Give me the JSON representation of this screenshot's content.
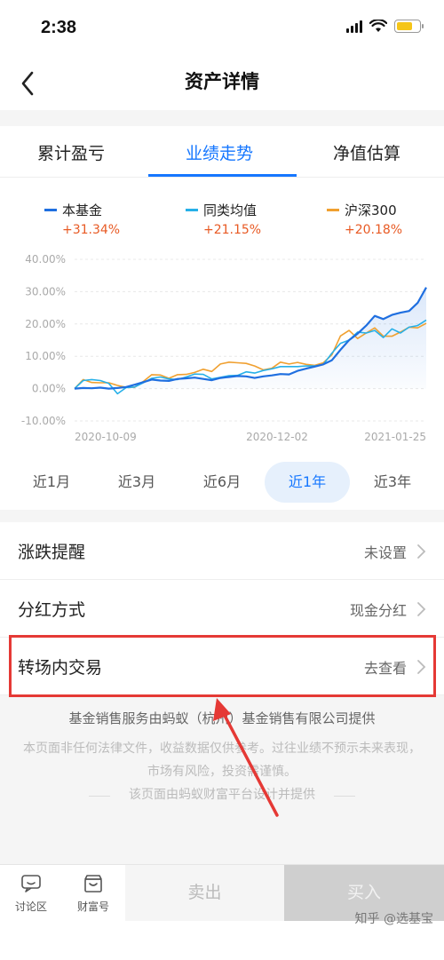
{
  "status_bar": {
    "time": "2:38",
    "battery_color": "#f5c518"
  },
  "nav": {
    "title": "资产详情",
    "back_icon": "chevron-left-icon"
  },
  "tabs": [
    {
      "label": "累计盈亏",
      "active": false
    },
    {
      "label": "业绩走势",
      "active": true
    },
    {
      "label": "净值估算",
      "active": false
    }
  ],
  "legend": [
    {
      "name": "本基金",
      "value": "+31.34%",
      "color": "#1f6fe0"
    },
    {
      "name": "同类均值",
      "value": "+21.15%",
      "color": "#26b0e8"
    },
    {
      "name": "沪深300",
      "value": "+20.18%",
      "color": "#f0a030"
    }
  ],
  "chart_data": {
    "type": "line",
    "ylabels": [
      "40.00%",
      "30.00%",
      "20.00%",
      "10.00%",
      "0.00%",
      "-10.00%"
    ],
    "ylim": [
      -10,
      40
    ],
    "xlabels": [
      "2020-10-09",
      "2020-12-02",
      "2021-01-25"
    ],
    "series": [
      {
        "name": "本基金",
        "color": "#1f6fe0",
        "values": [
          0,
          0.2,
          0.1,
          0.3,
          0,
          0.2,
          0.5,
          1.2,
          2.0,
          2.8,
          2.5,
          2.4,
          3.0,
          3.2,
          3.4,
          3.0,
          2.6,
          3.3,
          3.6,
          3.9,
          3.8,
          3.3,
          3.8,
          4.1,
          4.5,
          4.4,
          5.5,
          6.2,
          6.8,
          7.5,
          8.8,
          12,
          15,
          17,
          19.5,
          22.5,
          21.5,
          22.8,
          23.5,
          24,
          26.5,
          31.3
        ]
      },
      {
        "name": "同类均值",
        "color": "#26b0e8",
        "values": [
          0,
          2.5,
          2.8,
          2.5,
          1.6,
          -1.6,
          0.3,
          0.5,
          1.8,
          3.2,
          3.6,
          3.0,
          2.8,
          3.6,
          4.5,
          4.4,
          3.0,
          3.5,
          4.0,
          4.1,
          5.2,
          4.8,
          5.6,
          6.1,
          6.8,
          6.8,
          6.8,
          7.0,
          7.0,
          7.5,
          11,
          14,
          15,
          17.5,
          17.2,
          18,
          15.8,
          18.5,
          17.2,
          19,
          19.5,
          21.2
        ]
      },
      {
        "name": "沪深300",
        "color": "#f0a030",
        "values": [
          0,
          2.8,
          1.9,
          1.8,
          1.8,
          1.0,
          0.4,
          0.4,
          2.2,
          4.3,
          4.2,
          3.2,
          4.3,
          4.4,
          5.0,
          6.0,
          5.3,
          7.6,
          8.2,
          8.0,
          7.8,
          7.0,
          5.8,
          6.3,
          8.2,
          7.6,
          8.1,
          7.5,
          7.2,
          8.0,
          10.5,
          16.3,
          18.0,
          15.5,
          17.2,
          18.8,
          16.2,
          16.2,
          17.5,
          19.0,
          18.8,
          20.2
        ]
      }
    ]
  },
  "periods": [
    {
      "label": "近1月",
      "active": false
    },
    {
      "label": "近3月",
      "active": false
    },
    {
      "label": "近6月",
      "active": false
    },
    {
      "label": "近1年",
      "active": true
    },
    {
      "label": "近3年",
      "active": false
    }
  ],
  "rows": [
    {
      "label": "涨跌提醒",
      "value": "未设置"
    },
    {
      "label": "分红方式",
      "value": "现金分红"
    },
    {
      "label": "转场内交易",
      "value": "去查看"
    }
  ],
  "footer": {
    "provider": "基金销售服务由蚂蚁（杭州）基金销售有限公司提供",
    "disclaimer": "本页面非任何法律文件，收益数据仅供参考。过往业绩不预示未来表现，市场有风险，投资需谨慎。",
    "platform": "该页面由蚂蚁财富平台设计并提供"
  },
  "bottom_bar": {
    "discussion": "讨论区",
    "wealth": "财富号",
    "sell": "卖出",
    "buy": "买入",
    "watermark": "知乎 @选基宝"
  },
  "annotation_color": "#e53935"
}
